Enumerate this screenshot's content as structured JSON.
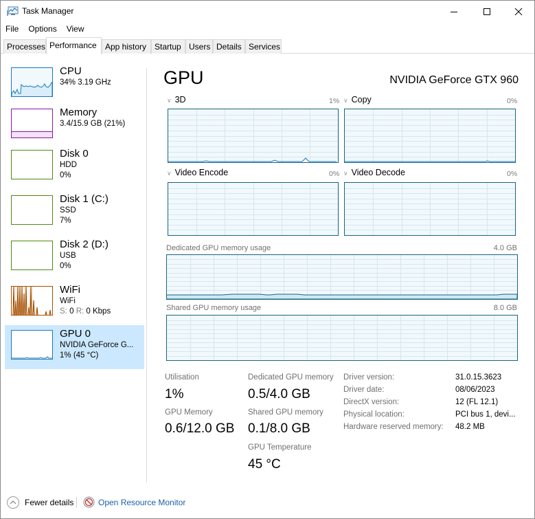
{
  "window": {
    "title": "Task Manager",
    "controls": {
      "minimize": "minimize",
      "maximize": "maximize",
      "close": "close"
    }
  },
  "menu": [
    "File",
    "Options",
    "View"
  ],
  "tabs": [
    {
      "label": "Processes",
      "active": false
    },
    {
      "label": "Performance",
      "active": true
    },
    {
      "label": "App history",
      "active": false
    },
    {
      "label": "Startup",
      "active": false
    },
    {
      "label": "Users",
      "active": false
    },
    {
      "label": "Details",
      "active": false
    },
    {
      "label": "Services",
      "active": false
    }
  ],
  "sidebar": {
    "items": [
      {
        "title": "CPU",
        "line1": "34% 3.19 GHz",
        "line2": "",
        "color": "#1779ba",
        "selected": false
      },
      {
        "title": "Memory",
        "line1": "3.4/15.9 GB (21%)",
        "line2": "",
        "color": "#8b12ae",
        "selected": false
      },
      {
        "title": "Disk 0",
        "line1": "HDD",
        "line2": "0%",
        "color": "#4d8a10",
        "selected": false
      },
      {
        "title": "Disk 1 (C:)",
        "line1": "SSD",
        "line2": "7%",
        "color": "#4d8a10",
        "selected": false
      },
      {
        "title": "Disk 2 (D:)",
        "line1": "USB",
        "line2": "0%",
        "color": "#4d8a10",
        "selected": false
      },
      {
        "title": "WiFi",
        "line1": "WiFi",
        "line2_s_label": "S:",
        "line2_s_value": "0",
        "line2_r_label": "R:",
        "line2_r_value": "0 Kbps",
        "color": "#a74f01",
        "selected": false
      },
      {
        "title": "GPU 0",
        "line1": "NVIDIA GeForce G...",
        "line2": "1% (45 °C)",
        "color": "#1779ba",
        "selected": true
      }
    ]
  },
  "main": {
    "title": "GPU",
    "device_name": "NVIDIA GeForce GTX 960",
    "engines": [
      {
        "label": "3D",
        "percent": "1%"
      },
      {
        "label": "Copy",
        "percent": "0%"
      },
      {
        "label": "Video Encode",
        "percent": "0%"
      },
      {
        "label": "Video Decode",
        "percent": "0%"
      }
    ],
    "dedicated_memory_graph": {
      "label": "Dedicated GPU memory usage",
      "max": "4.0 GB"
    },
    "shared_memory_graph": {
      "label": "Shared GPU memory usage",
      "max": "8.0 GB"
    },
    "stats": {
      "utilisation": {
        "label": "Utilisation",
        "value": "1%"
      },
      "dedicated": {
        "label": "Dedicated GPU memory",
        "value": "0.5/4.0 GB"
      },
      "gpu_memory": {
        "label": "GPU Memory",
        "value": "0.6/12.0 GB"
      },
      "shared": {
        "label": "Shared GPU memory",
        "value": "0.1/8.0 GB"
      },
      "temperature": {
        "label": "GPU Temperature",
        "value": "45 °C"
      }
    },
    "info": [
      {
        "label": "Driver version:",
        "value": "31.0.15.3623"
      },
      {
        "label": "Driver date:",
        "value": "08/06/2023"
      },
      {
        "label": "DirectX version:",
        "value": "12 (FL 12.1)"
      },
      {
        "label": "Physical location:",
        "value": "PCI bus 1, devi..."
      },
      {
        "label": "Hardware reserved memory:",
        "value": "48.2 MB"
      }
    ]
  },
  "footer": {
    "fewer_details": "Fewer details",
    "open_resource_monitor": "Open Resource Monitor"
  },
  "colors": {
    "accent_blue": "#1779ba",
    "graph_border": "#17647d",
    "selected_bg": "#cce8ff",
    "link": "#1a5fa8"
  }
}
